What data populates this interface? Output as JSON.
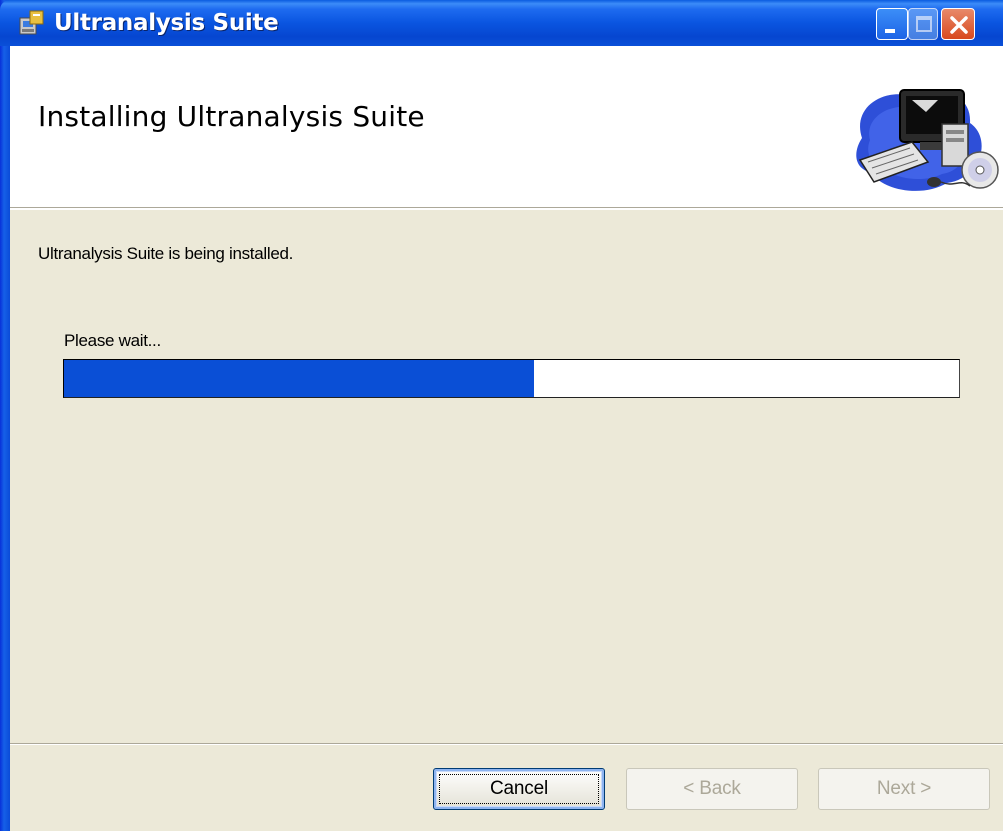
{
  "window": {
    "title": "Ultranalysis Suite",
    "icon": "installer-icon"
  },
  "banner": {
    "title": "Installing Ultranalysis Suite",
    "graphic": "computer-install-graphic"
  },
  "body": {
    "status_text": "Ultranalysis Suite is being installed.",
    "wait_label": "Please wait...",
    "progress_fraction": 0.525
  },
  "buttons": {
    "cancel": "Cancel",
    "back": "< Back",
    "next": "Next >"
  },
  "colors": {
    "titlebar": "#0A55E0",
    "progress_fill": "#0A4FD6",
    "dialog_bg": "#ECE9D8"
  }
}
